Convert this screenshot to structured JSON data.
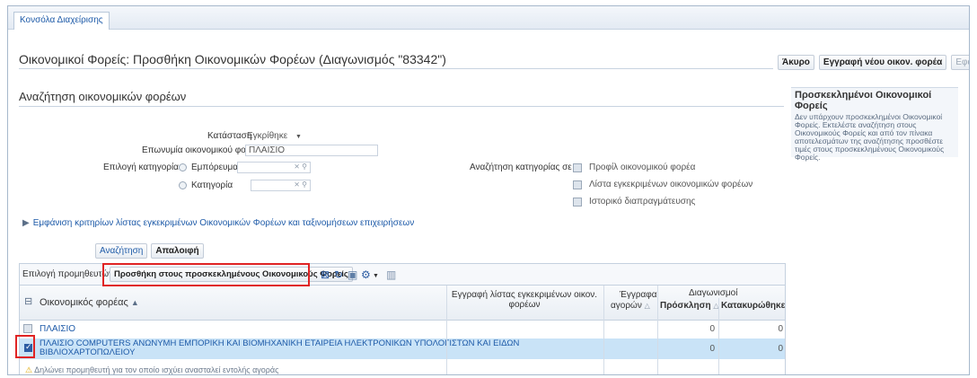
{
  "tab": {
    "label": "Κονσόλα Διαχείρισης"
  },
  "page": {
    "title": "Οικονομικοί Φορείς: Προσθήκη Οικονομικών Φορέων (Διαγωνισμός \"83342\")"
  },
  "actions": {
    "cancel": "Άκυρο",
    "register": "Εγγραφή νέου οικον. φορέα",
    "apply": "Εφαρμογή"
  },
  "search": {
    "section_title": "Αναζήτηση οικονομικών φορέων",
    "status_label": "Κατάσταση",
    "status_value": "Εγκρίθηκε",
    "name_label": "Επωνυμία οικονομικού φορέα",
    "name_value": "ΠΛΑΙΣΙΟ",
    "category_select_label": "Επιλογή κατηγορίας",
    "radio_commodity": "Εμπόρευμα",
    "radio_category": "Κατηγορία",
    "search_in_label": "Αναζήτηση κατηγορίας σε",
    "checkbox_profile": "Προφίλ οικονομικού φορέα",
    "checkbox_approved_list": "Λίστα εγκεκριμένων οικονομικών φορέων",
    "checkbox_history": "Ιστορικό διαπραγμάτευσης",
    "toggle_criteria": "Εμφάνιση κριτηρίων λίστας εγκεκριμένων Οικονομικών Φορέων και ταξινομήσεων επιχειρήσεων",
    "search_button": "Αναζήτηση",
    "clear_button": "Απαλοιφή"
  },
  "side_panel": {
    "title": "Προσκεκλημένοι Οικονομικοί Φορείς",
    "text": "Δεν υπάρχουν προσκεκλημένοι Οικονομικοί Φορείς. Εκτελέστε αναζήτηση στους Οικονομικούς Φορείς και από τον πίνακα αποτελεσμάτων της αναζήτησης προσθέστε τιμές στους προσκεκλημένους Οικονομικούς Φορείς."
  },
  "results": {
    "select_label": "Επιλογή προμηθευτών:",
    "add_button": "Προσθήκη στους προσκεκλημένους Οικονομικούς Φορείς",
    "col_supplier": "Οικονομικός φορέας",
    "col_approved_list": "Εγγραφή λίστας εγκεκριμένων οικον. φορέων",
    "col_registration_1": "Έγγραφα",
    "col_registration_2": "αγορών",
    "col_tenders": "Διαγωνισμοί",
    "col_invitation": "Πρόσκληση",
    "col_awarded": "Κατακυρώθηκε",
    "rows": [
      {
        "name": "ΠΛΑΙΣΙΟ",
        "invitation": "0",
        "awarded": "0"
      },
      {
        "name_line1": "ΠΛΑΙΣΙΟ COMPUTERS ΑΝΩΝΥΜΗ ΕΜΠΟΡΙΚΗ ΚΑΙ ΒΙΟΜΗΧΑΝΙΚΗ ΕΤΑΙΡΕΙΑ ΗΛΕΚΤΡΟΝΙΚΩΝ ΥΠΟΛΟΓΙΣΤΩΝ ΚΑΙ ΕΙΔΩΝ",
        "name_line2": "ΒΙΒΛΙΟΧΑΡΤΟΠΩΛΕΙΟΥ",
        "invitation": "0",
        "awarded": "0"
      }
    ],
    "footnote": "Δηλώνει προμηθευτή για τον οποίο ισχύει ανασταλεί εντολής αγοράς"
  },
  "icons": {
    "sort": "sort-asc-icon",
    "export": "export-icon",
    "refresh": "refresh-icon",
    "detach": "detach-icon",
    "settings": "gear-icon",
    "freeze": "freeze-icon",
    "warning": "warning-icon"
  }
}
